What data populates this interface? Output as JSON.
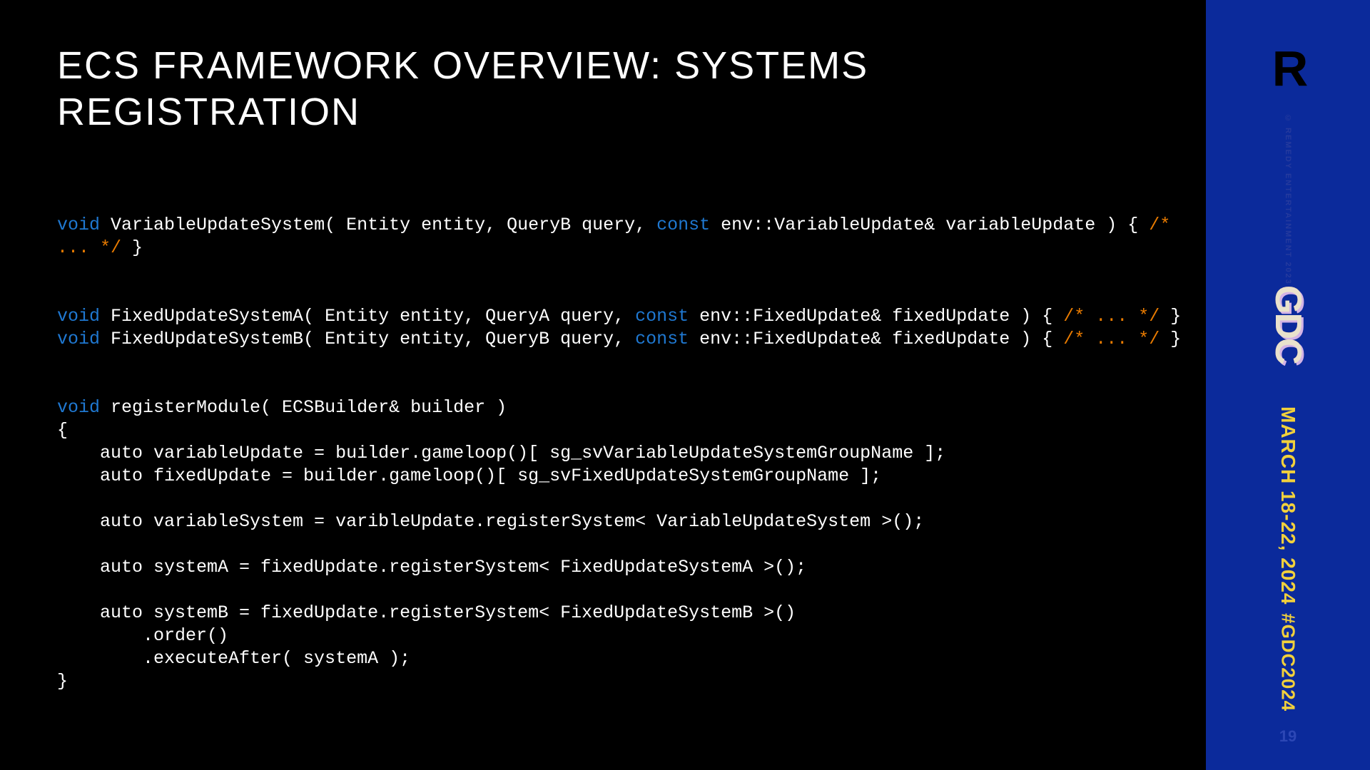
{
  "title": "ECS FRAMEWORK OVERVIEW: SYSTEMS REGISTRATION",
  "code": {
    "kw_void": "void",
    "kw_const": "const",
    "line1a": " VariableUpdateSystem( Entity entity, QueryB query, ",
    "line1b": " env::VariableUpdate& variableUpdate ) { ",
    "line1c": "/* \n... */",
    "line1d": " }",
    "line3a": " FixedUpdateSystemA( Entity entity, QueryA query, ",
    "line3b": " env::FixedUpdate& fixedUpdate ) { ",
    "line3c": "/* ... */",
    "line3d": " }",
    "line4a": " FixedUpdateSystemB( Entity entity, QueryB query, ",
    "line4b": " env::FixedUpdate& fixedUpdate ) { ",
    "line4c": "/* ... */",
    "line4d": " }",
    "line6": " registerModule( ECSBuilder& builder )",
    "body": "{\n    auto variableUpdate = builder.gameloop()[ sg_svVariableUpdateSystemGroupName ];\n    auto fixedUpdate = builder.gameloop()[ sg_svFixedUpdateSystemGroupName ];\n\n    auto variableSystem = varibleUpdate.registerSystem< VariableUpdateSystem >();\n\n    auto systemA = fixedUpdate.registerSystem< FixedUpdateSystemA >();\n\n    auto systemB = fixedUpdate.registerSystem< FixedUpdateSystemB >()\n        .order()\n        .executeAfter( systemA );\n}"
  },
  "sidebar": {
    "brand_logo": "R",
    "copyright": "© REMEDY ENTERTAINMENT 2023",
    "gdc": "GDC",
    "date": "MARCH 18-22, 2024",
    "hashtag": "#GDC2024",
    "page": "19"
  }
}
